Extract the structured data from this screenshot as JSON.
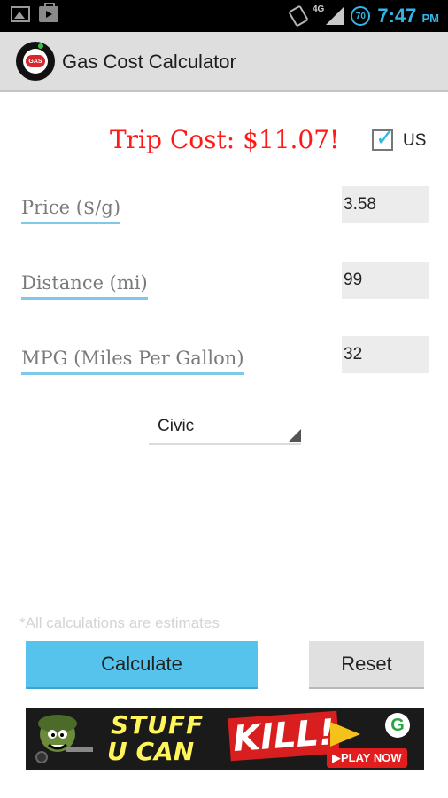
{
  "status_bar": {
    "network": "4G",
    "battery": "70",
    "time": "7:47",
    "ampm": "PM",
    "icons": [
      "picture-icon",
      "play-store-icon",
      "vibrate-icon",
      "signal-icon",
      "battery-icon"
    ]
  },
  "action_bar": {
    "logo_text": "GAS",
    "title": "Gas Cost Calculator"
  },
  "trip_cost": "Trip Cost: $11.07!",
  "units": {
    "label": "US",
    "checked": true
  },
  "fields": [
    {
      "label": "Price ($/g)",
      "value": "3.58"
    },
    {
      "label": "Distance (mi)",
      "value": "99"
    },
    {
      "label": "MPG (Miles Per Gallon)",
      "value": "32"
    }
  ],
  "vehicle_spinner": {
    "selected": "Civic"
  },
  "disclaimer": "*All calculations are estimates",
  "buttons": {
    "calculate": "Calculate",
    "reset": "Reset"
  },
  "ad": {
    "line1": "STUFF",
    "line2": "U CAN",
    "highlight": "KILL!",
    "cta": "▶PLAY NOW",
    "badge": "G"
  },
  "colors": {
    "accent": "#33b5e5",
    "calculate_button": "#55c3ec",
    "trip_cost": "#ff1a1a",
    "label_underline": "#7fc8ea"
  }
}
